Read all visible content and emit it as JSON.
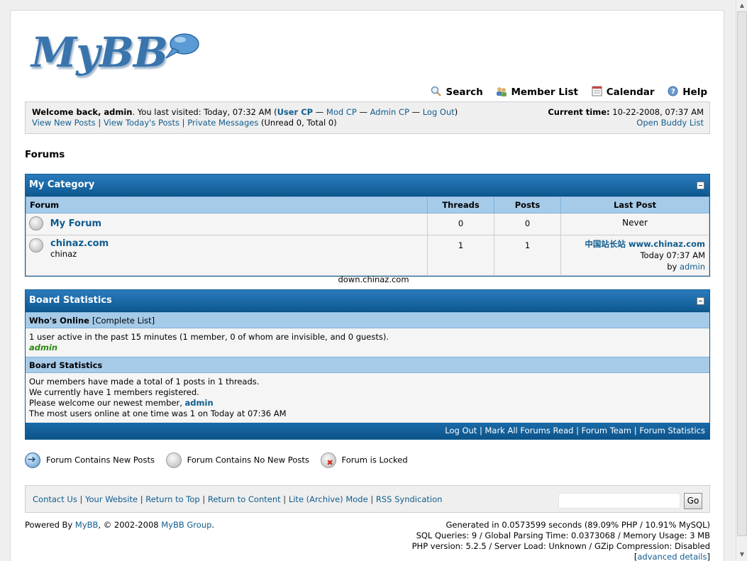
{
  "logo": {
    "text": "MyBB"
  },
  "menu": [
    {
      "label": "Search",
      "icon": "search-icon"
    },
    {
      "label": "Member List",
      "icon": "members-icon"
    },
    {
      "label": "Calendar",
      "icon": "calendar-icon"
    },
    {
      "label": "Help",
      "icon": "help-icon"
    }
  ],
  "panel": {
    "welcome_prefix": "Welcome back, admin",
    "last_visit": ". You last visited: Today, 07:32 AM (",
    "user_cp": "User CP",
    "mod_cp": "Mod CP",
    "admin_cp": "Admin CP",
    "logout": "Log Out",
    "dash": "—",
    "close_paren": ")",
    "view_new_posts": "View New Posts",
    "view_today_posts": "View Today's Posts",
    "private_messages": "Private Messages",
    "pm_count": "(Unread 0, Total 0)",
    "current_time_label": "Current time:",
    "current_time_value": "10-22-2008, 07:37 AM",
    "open_buddy_list": "Open Buddy List"
  },
  "nav_title": "Forums",
  "category": {
    "title": "My Category",
    "columns": {
      "forum": "Forum",
      "threads": "Threads",
      "posts": "Posts",
      "last_post": "Last Post"
    },
    "forums": [
      {
        "name": "My Forum",
        "description": "",
        "threads": "0",
        "posts": "0",
        "last_post_title": "Never",
        "last_post_time": "",
        "last_post_by": "",
        "last_post_user": ""
      },
      {
        "name": "chinaz.com",
        "description": "chinaz",
        "threads": "1",
        "posts": "1",
        "last_post_title": "中国站长站  www.chinaz.com",
        "last_post_time": "Today 07:37 AM",
        "last_post_by": "by",
        "last_post_user": "admin"
      }
    ]
  },
  "watermark": "down.chinaz.com",
  "stats": {
    "title": "Board Statistics",
    "whos_online_label": "Who's Online",
    "complete_list": "[Complete List]",
    "online_text": "1 user active in the past 15 minutes (1 member, 0 of whom are invisible, and 0 guests).",
    "online_user": "admin",
    "board_stats_label": "Board Statistics",
    "line1": "Our members have made a total of 1 posts in 1 threads.",
    "line2": "We currently have 1 members registered.",
    "line3_prefix": "Please welcome our newest member,",
    "newest_member": "admin",
    "line4": "The most users online at one time was 1 on Today at 07:36 AM",
    "footer_links": [
      "Log Out",
      "Mark All Forums Read",
      "Forum Team",
      "Forum Statistics"
    ]
  },
  "legend": {
    "new_posts": "Forum Contains New Posts",
    "no_new_posts": "Forum Contains No New Posts",
    "locked": "Forum is Locked"
  },
  "bottom_menu": {
    "links": [
      "Contact Us",
      "Your Website",
      "Return to Top",
      "Return to Content",
      "Lite (Archive) Mode",
      "RSS Syndication"
    ],
    "search_value": "",
    "go_label": "Go"
  },
  "copyright": {
    "powered_by": "Powered By",
    "mybb": "MyBB",
    "years": ", © 2002-2008",
    "group": "MyBB Group",
    "dot": "."
  },
  "debug": {
    "line1": "Generated in 0.0573599 seconds (89.09% PHP / 10.91% MySQL)",
    "line2": "SQL Queries: 9 / Global Parsing Time: 0.0373068 / Memory Usage: 3 MB",
    "line3": "PHP version: 5.2.5 / Server Load: Unknown / GZip Compression: Disabled",
    "advanced_open": "[",
    "advanced_details": "advanced details",
    "advanced_close": "]"
  }
}
